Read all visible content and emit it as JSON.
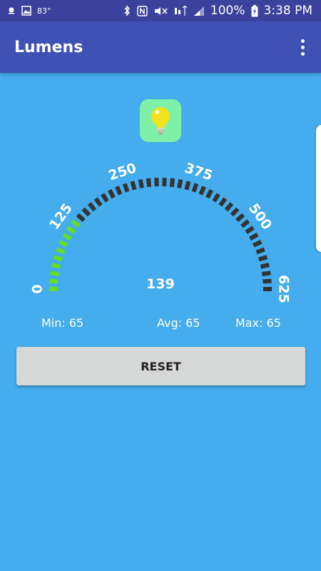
{
  "status_bar": {
    "temperature": "83°",
    "battery": "100%",
    "time": "3:38 PM",
    "background_color": "#3a429c",
    "left_icons": [
      "weather-icon",
      "image-icon"
    ],
    "right_icons": [
      "bluetooth-icon",
      "nfc-icon",
      "mute-icon",
      "lte-icon",
      "signal-icon",
      "battery-icon"
    ]
  },
  "app_bar": {
    "title": "Lumens",
    "background_color": "#3f51b5",
    "menu_icon": "more-vert-icon"
  },
  "badge": {
    "icon": "lightbulb-icon",
    "background_color": "#7ef0a8"
  },
  "gauge": {
    "min": 0,
    "max": 625,
    "current": 139,
    "reading": "139",
    "tick_labels": [
      "0",
      "125",
      "250",
      "375",
      "500",
      "625"
    ],
    "active_color": "#62dd22",
    "inactive_color": "#333333"
  },
  "stats": {
    "min_label": "Min:",
    "min_value": "65",
    "avg_label": "Avg:",
    "avg_value": "65",
    "max_label": "Max:",
    "max_value": "65"
  },
  "reset_button": {
    "label": "RESET"
  },
  "background_color": "#45aced"
}
